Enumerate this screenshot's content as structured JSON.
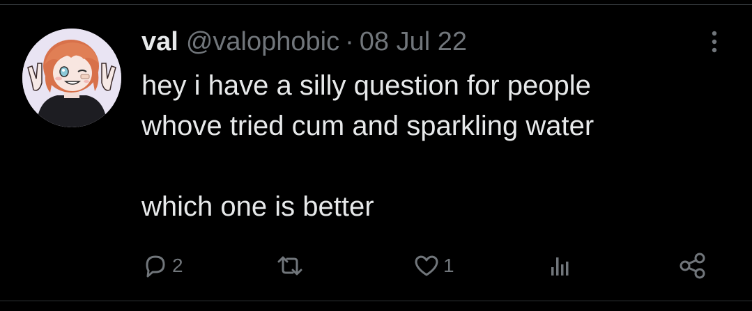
{
  "tweet": {
    "display_name": "val",
    "handle": "@valophobic",
    "separator": "·",
    "date": "08 Jul 22",
    "text_lines": [
      "hey i have a silly question for people",
      "whove tried cum and sparkling water",
      "",
      "which one is better"
    ]
  },
  "actions": {
    "reply": {
      "icon": "reply-icon",
      "count": "2"
    },
    "retweet": {
      "icon": "retweet-icon",
      "count": ""
    },
    "like": {
      "icon": "heart-icon",
      "count": "1"
    },
    "views": {
      "icon": "analytics-icon",
      "count": ""
    },
    "share": {
      "icon": "share-icon",
      "count": ""
    }
  },
  "colors": {
    "background": "#000000",
    "primary_text": "#e7e9ea",
    "secondary_text": "#71767b",
    "divider": "#2f3336"
  }
}
